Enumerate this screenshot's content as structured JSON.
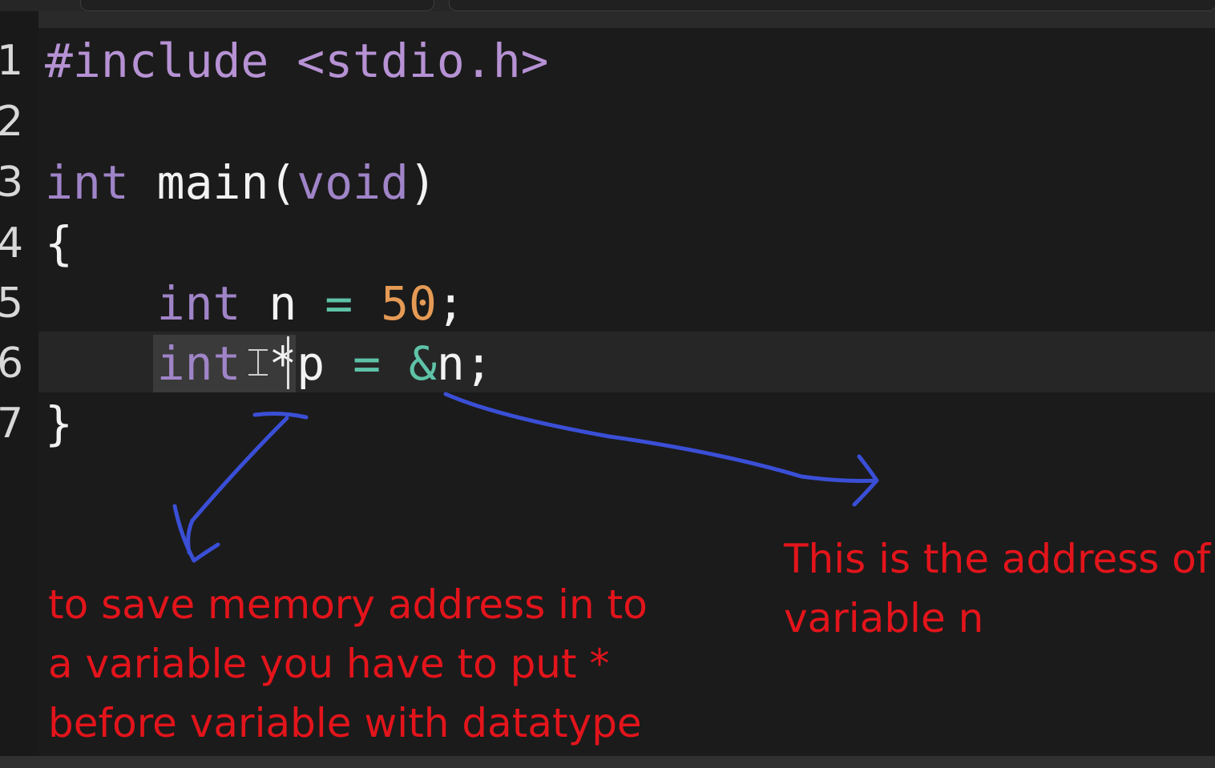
{
  "editor": {
    "line_numbers": [
      "1",
      "2",
      "3",
      "4",
      "5",
      "6",
      "7"
    ],
    "lines": [
      [
        {
          "t": "#include",
          "c": "pre"
        },
        {
          "t": " ",
          "c": "txt"
        },
        {
          "t": "<stdio.h>",
          "c": "str"
        }
      ],
      [],
      [
        {
          "t": "int",
          "c": "kw"
        },
        {
          "t": " main(",
          "c": "fn"
        },
        {
          "t": "void",
          "c": "kw"
        },
        {
          "t": ")",
          "c": "fn"
        }
      ],
      [
        {
          "t": "{",
          "c": "txt"
        }
      ],
      [
        {
          "t": "    ",
          "c": "txt"
        },
        {
          "t": "int",
          "c": "kw"
        },
        {
          "t": " n ",
          "c": "txt"
        },
        {
          "t": "=",
          "c": "op"
        },
        {
          "t": " ",
          "c": "txt"
        },
        {
          "t": "50",
          "c": "num"
        },
        {
          "t": ";",
          "c": "txt"
        }
      ],
      [
        {
          "t": "    ",
          "c": "txt"
        },
        {
          "t": "int",
          "c": "kw"
        },
        {
          "t": " *",
          "c": "txt"
        },
        {
          "t": "p ",
          "c": "txt"
        },
        {
          "t": "=",
          "c": "op"
        },
        {
          "t": " ",
          "c": "txt"
        },
        {
          "t": "&",
          "c": "amp"
        },
        {
          "t": "n;",
          "c": "txt"
        }
      ],
      [
        {
          "t": "}",
          "c": "txt"
        }
      ]
    ],
    "active_line": 6,
    "colors": {
      "background": "#1b1b1b",
      "keyword": "#a084c8",
      "number": "#e59a55",
      "operator": "#5ec3a8",
      "annotation": "#e3141b",
      "arrow": "#3a4fd6"
    }
  },
  "annotations": {
    "pointer_note": [
      "to save memory address in to",
      "a variable you have to put *",
      "before variable with datatype"
    ],
    "address_note": [
      "This is the address of",
      "variable n"
    ]
  },
  "icons": {
    "text_cursor": "i-beam-cursor-icon"
  }
}
